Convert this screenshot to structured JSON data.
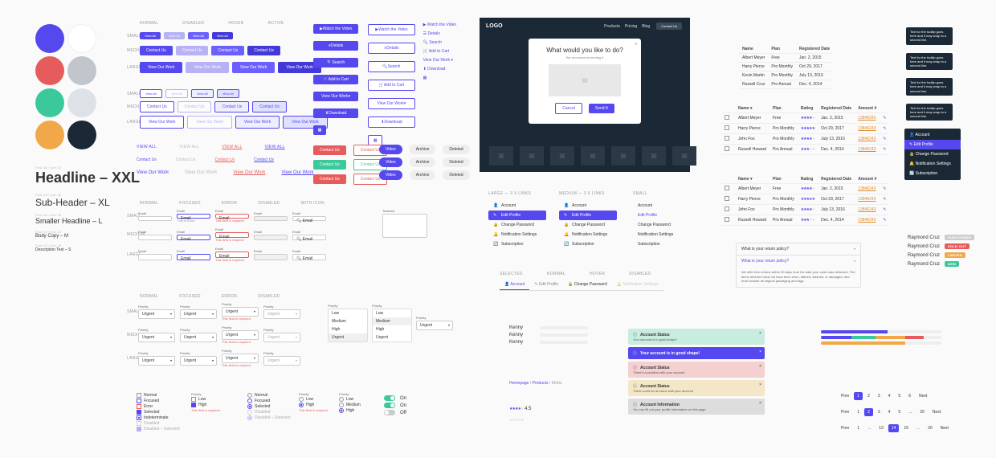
{
  "colors": {
    "primary": "#5448ee",
    "white": "#ffffff",
    "red": "#e65c5c",
    "gray": "#c0c6cc",
    "green": "#3bc99b",
    "dark": "#1a2935",
    "orange": "#f0a848"
  },
  "typography": {
    "xxl": "Headline – XXL",
    "xl": "Sub-Header – XL",
    "l": "Smaller Headline – L",
    "body_meta": "Font: 14 / Line: 21",
    "body": "Body Copy – M",
    "desc_meta": "Font: 12 / Line: 18",
    "desc": "Description Text – S",
    "xxl_meta": "Font: 36 / Line: 42",
    "xl_meta": "Font: 24 / Line: 32",
    "l_meta": "Font: 18 / Line: 26"
  },
  "btn_states": {
    "normal": "NORMAL",
    "disabled": "DISABLED",
    "hover": "HOVER",
    "active": "ACTIVE"
  },
  "sizes": {
    "s": "SMALL",
    "m": "MEDIUM",
    "l": "LARGE"
  },
  "btns": {
    "view_all": "View All",
    "contact_us": "Contact Us",
    "view_work": "View Our Work",
    "watch_video": "Watch the Video",
    "details": "Details",
    "search": "Search",
    "add_cart": "Add to Cart",
    "download": "Download",
    "video": "Video",
    "archive": "Archive",
    "deleted": "Deleted",
    "send": "Send It",
    "cancel": "Cancel"
  },
  "link": {
    "contact": "Contact Us",
    "view_all": "View All",
    "view_work": "View Our Work"
  },
  "input": {
    "label": "Email",
    "placeholder": "Email",
    "err": "This field is required",
    "hint": "This is a hint",
    "textarea": "Textarea"
  },
  "select": {
    "label": "Priority",
    "value": "Urgent",
    "err": "This field is required",
    "opts": [
      "Low",
      "Medium",
      "High",
      "Urgent"
    ]
  },
  "check": {
    "normal": "Normal",
    "focused": "Focused",
    "error": "Error",
    "selected": "Selected",
    "indeterminate": "Indeterminate",
    "disabled": "Disabled",
    "disabled_sel": "Disabled – Selected",
    "err": "This field is required"
  },
  "radio": {
    "low": "Low",
    "medium": "Medium",
    "high": "High",
    "label": "Priority"
  },
  "modal": {
    "logo": "LOGO",
    "nav": [
      "Products",
      "Pricing",
      "Blog"
    ],
    "cta": "Contact Us",
    "title": "What would you like to do?",
    "sub": "We recommend sending it",
    "cancel": "Cancel",
    "confirm": "Send It"
  },
  "table": {
    "cols": [
      "Name",
      "Plan",
      "Registered Date"
    ],
    "rows": [
      {
        "n": "Albert Meyer",
        "p": "Free",
        "d": "Jan. 2, 2015"
      },
      {
        "n": "Harry Pierce",
        "p": "Pro Monthly",
        "d": "Oct 29, 2017"
      },
      {
        "n": "Kevin Martin",
        "p": "Pro Monthly",
        "d": "July 13, 2016"
      },
      {
        "n": "Russell Cruz",
        "p": "Pro Annual",
        "d": "Dec. 4, 2014"
      }
    ],
    "cols2": [
      "",
      "Name",
      "Plan",
      "Rating",
      "Registered Date",
      "Amount #",
      ""
    ],
    "rows2": [
      {
        "n": "Albert Meyer",
        "p": "Free",
        "r": 4,
        "d": "Jan. 2, 2015",
        "a": "13846243"
      },
      {
        "n": "Harry Pierce",
        "p": "Pro Monthly",
        "r": 5,
        "d": "Oct 29, 2017",
        "a": "13846243"
      },
      {
        "n": "John Fox",
        "p": "Pro Monthly",
        "r": 4,
        "d": "July 13, 2016",
        "a": "13846243"
      },
      {
        "n": "Russell Howard",
        "p": "Pro Annual",
        "r": 3,
        "d": "Dec. 4, 2014",
        "a": "13846243"
      }
    ]
  },
  "nav_headers": {
    "large": "LARGE — 3 X LINKS",
    "medium": "MEDIUM — 3 X LINKS",
    "small": "SMALL"
  },
  "vnav": {
    "items": [
      "Account",
      "Edit Profile",
      "Change Password",
      "Notification Settings",
      "Subscription"
    ]
  },
  "tabs": {
    "items": [
      "Account",
      "Edit Profile",
      "Change Password",
      "Notification Settings"
    ],
    "states": [
      "SELECTED",
      "NORMAL",
      "HOVER",
      "DISABLED"
    ]
  },
  "bc": {
    "home": "Homepage",
    "products": "Products",
    "current": "Shirts"
  },
  "skel": [
    "Kenny",
    "Kenny",
    "Kenny"
  ],
  "alerts": [
    {
      "cls": "al-g",
      "t": "Account Status",
      "s": "Your account is in good shape!"
    },
    {
      "cls": "al-b",
      "t": "Your account is in good shape!",
      "s": ""
    },
    {
      "cls": "al-r",
      "t": "Account Status",
      "s": "There's a problem with your account"
    },
    {
      "cls": "al-y",
      "t": "Account Status",
      "s": "There could be an issue with your account"
    },
    {
      "cls": "al-gr",
      "t": "Account Information",
      "s": "You can fill out your profile information on this page"
    }
  ],
  "acc": {
    "q": "What is your return policy?",
    "a": "We offer free returns within 30 days from the date your order was delivered. The items returned must not have been worn, altered, washed, or damaged, and must include all original packaging and tags."
  },
  "tooltip": "Text for the tooltip goes here and it may wrap to a second line.",
  "badges": {
    "name": "Raymond Cruz",
    "subscriber": "SUBSCRIBER",
    "soldout": "SOLD OUT",
    "limited": "LIMITED",
    "new": "NEW"
  },
  "pagination": {
    "prev": "Prev",
    "next": "Next",
    "pages1": [
      "1",
      "2",
      "3",
      "4",
      "5",
      "6"
    ],
    "pages2": [
      "1",
      "2",
      "3",
      "4",
      "5",
      "...",
      "20"
    ],
    "pages3": [
      "1",
      "...",
      "13",
      "14",
      "15",
      "...",
      "20"
    ]
  },
  "rating": {
    "score": "4.5"
  }
}
